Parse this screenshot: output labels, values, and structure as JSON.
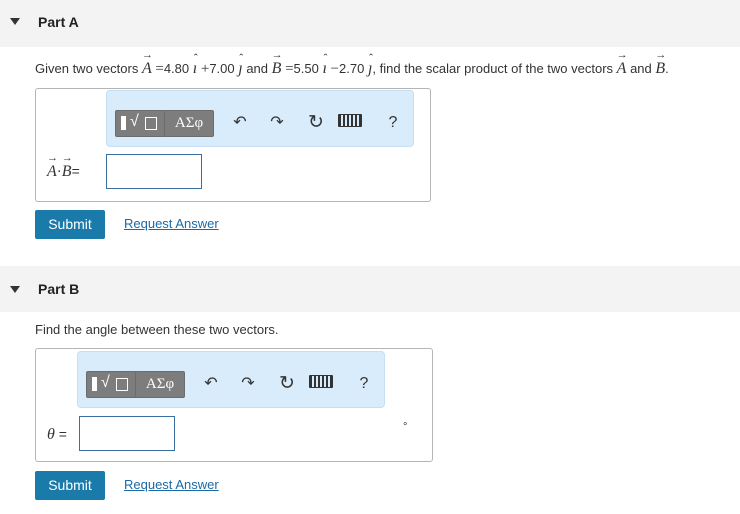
{
  "part_a": {
    "title": "Part A",
    "question_prefix": "Given two vectors",
    "vec_a": "A",
    "vec_b": "B",
    "eq": "=",
    "a_x": "4.80",
    "a_y": "7.00",
    "b_x": "5.50",
    "b_y": "2.70",
    "plus": "+",
    "minus": "−",
    "i": "ı",
    "j": "ȷ",
    "and_text": "and",
    "question_suffix": ", find the scalar product of the two vectors",
    "period": ".",
    "dot": "·",
    "label_eq": "=",
    "submit_label": "Submit",
    "request_label": "Request Answer"
  },
  "part_b": {
    "title": "Part B",
    "question": "Find the angle between these two vectors.",
    "theta": "θ",
    "label_eq": "=",
    "unit": "°",
    "submit_label": "Submit",
    "request_label": "Request Answer"
  },
  "toolbar": {
    "sqrt_symbol": "√",
    "greek_label": "ΑΣφ",
    "undo_icon": "↶",
    "redo_icon": "↷",
    "reset_icon": "↻",
    "help_label": "?"
  }
}
